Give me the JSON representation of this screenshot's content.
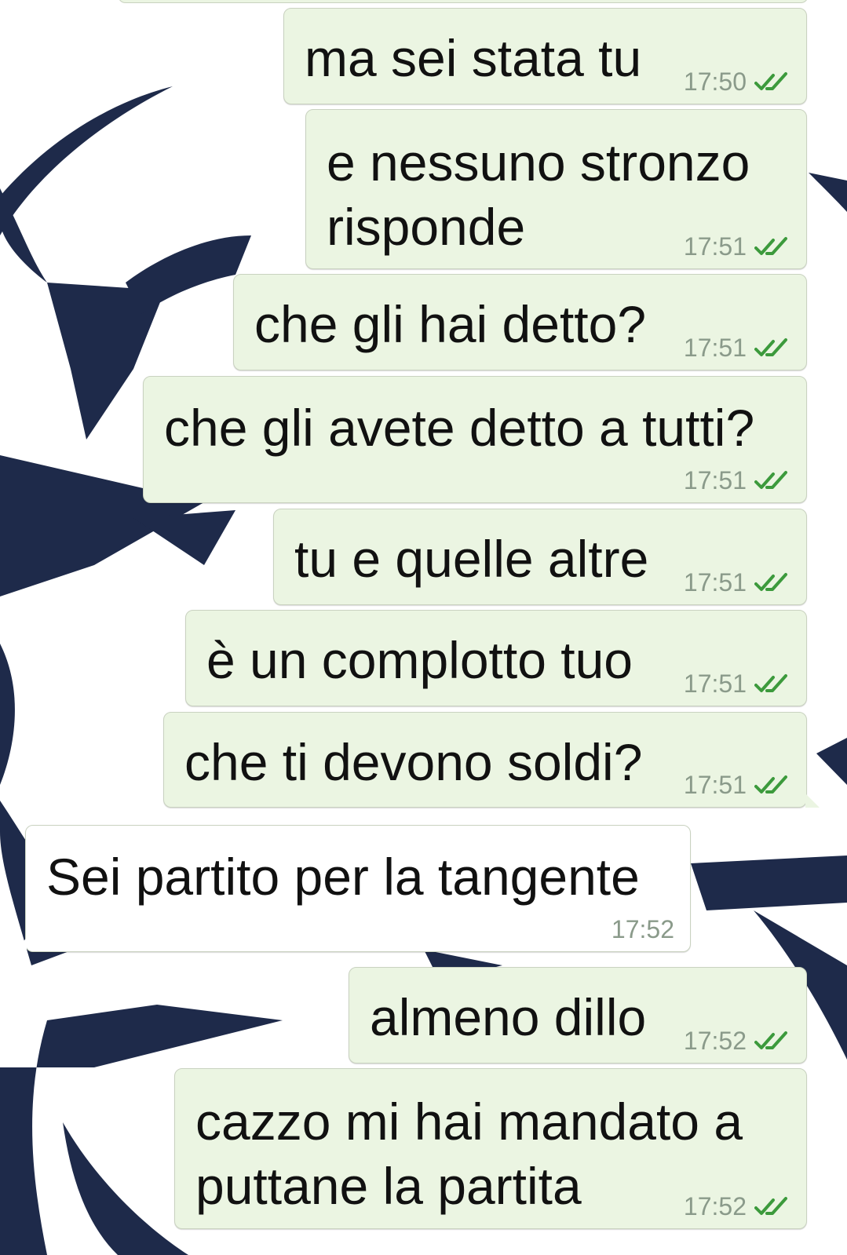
{
  "wallpaper": {
    "primary_color": "#1e2a4a",
    "background_color": "#ffffff"
  },
  "colors": {
    "outgoing_bubble": "#ebf5e2",
    "incoming_bubble": "#ffffff",
    "tick": "#3c9a3c",
    "time_text": "#8a9a8a"
  },
  "messages": [
    {
      "text": "ma sei stata tu",
      "time": "17:50",
      "direction": "outgoing",
      "status_icon": "double-check-icon"
    },
    {
      "text": "e nessuno stronzo\nrisponde",
      "time": "17:51",
      "direction": "outgoing",
      "status_icon": "double-check-icon"
    },
    {
      "text": "che gli hai detto?",
      "time": "17:51",
      "direction": "outgoing",
      "status_icon": "double-check-icon"
    },
    {
      "text": "che gli avete detto a tutti?",
      "time": "17:51",
      "direction": "outgoing",
      "status_icon": "double-check-icon"
    },
    {
      "text": "tu e quelle altre",
      "time": "17:51",
      "direction": "outgoing",
      "status_icon": "double-check-icon"
    },
    {
      "text": "è un complotto tuo",
      "time": "17:51",
      "direction": "outgoing",
      "status_icon": "double-check-icon"
    },
    {
      "text": "che ti devono soldi?",
      "time": "17:51",
      "direction": "outgoing",
      "status_icon": "double-check-icon"
    },
    {
      "text": "Sei partito per la tangente",
      "time": "17:52",
      "direction": "incoming"
    },
    {
      "text": "almeno dillo",
      "time": "17:52",
      "direction": "outgoing",
      "status_icon": "double-check-icon"
    },
    {
      "text": "cazzo mi hai mandato a\nputtane la partita",
      "time": "17:52",
      "direction": "outgoing",
      "status_icon": "double-check-icon"
    }
  ]
}
